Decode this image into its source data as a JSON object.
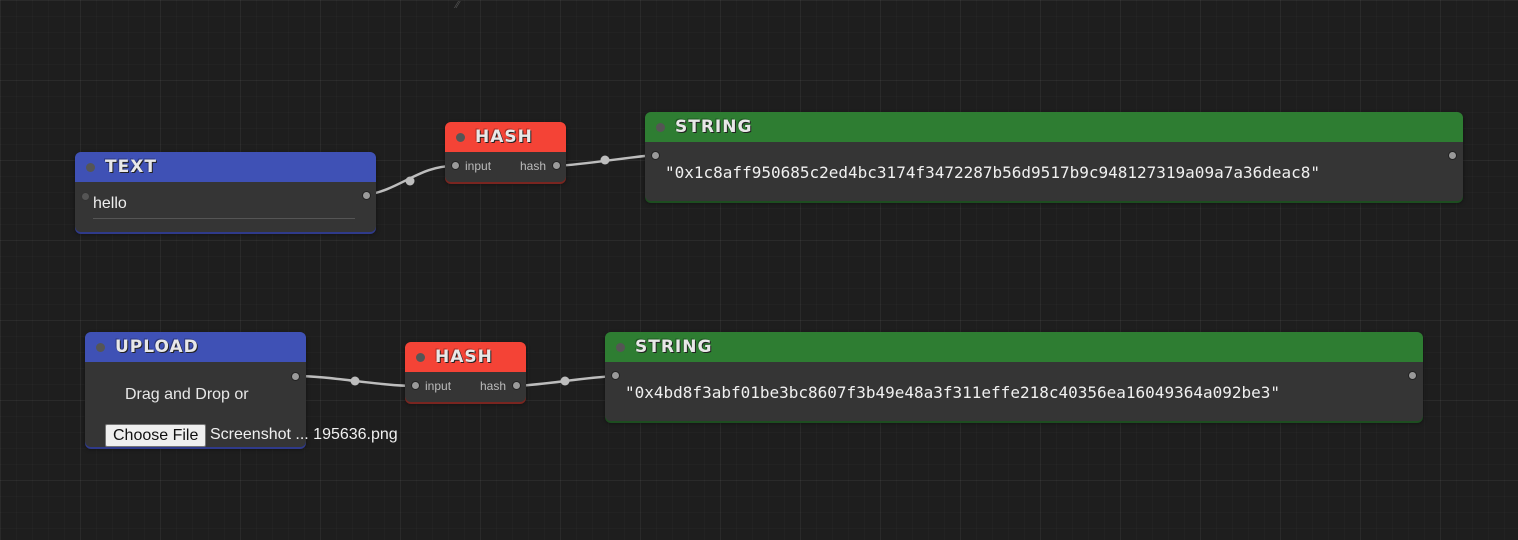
{
  "nodes": {
    "text": {
      "title": "TEXT",
      "value": "hello"
    },
    "hash1": {
      "title": "HASH",
      "input_label": "input",
      "output_label": "hash"
    },
    "string1": {
      "title": "STRING",
      "value": "\"0x1c8aff950685c2ed4bc3174f3472287b56d9517b9c948127319a09a7a36deac8\""
    },
    "upload": {
      "title": "UPLOAD",
      "drag_text": "Drag and Drop or",
      "button_label": "Choose File",
      "file_name": "Screenshot ... 195636.png"
    },
    "hash2": {
      "title": "HASH",
      "input_label": "input",
      "output_label": "hash"
    },
    "string2": {
      "title": "STRING",
      "value": "\"0x4bd8f3abf01be3bc8607f3b49e48a3f311effe218c40356ea16049364a092be3\""
    }
  },
  "colors": {
    "input_node": "#3f51b5",
    "hash_node": "#f44336",
    "output_node": "#2e7d32",
    "canvas": "#1e1e1e",
    "node_body": "#353535"
  }
}
